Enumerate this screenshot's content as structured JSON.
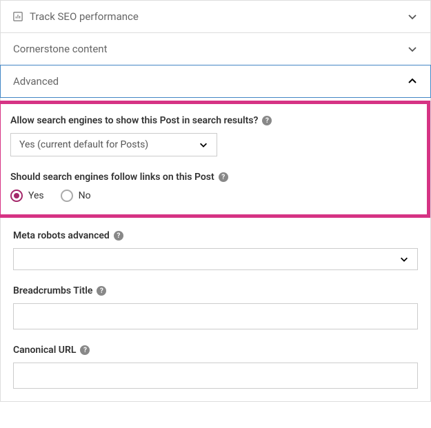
{
  "sections": {
    "seo": {
      "title": "Track SEO performance"
    },
    "cornerstone": {
      "title": "Cornerstone content"
    },
    "advanced": {
      "title": "Advanced"
    }
  },
  "advanced": {
    "allow_search": {
      "label": "Allow search engines to show this Post in search results?",
      "selected": "Yes (current default for Posts)"
    },
    "follow_links": {
      "label": "Should search engines follow links on this Post",
      "yes": "Yes",
      "no": "No"
    },
    "meta_robots": {
      "label": "Meta robots advanced",
      "selected": ""
    },
    "breadcrumbs": {
      "label": "Breadcrumbs Title",
      "value": ""
    },
    "canonical": {
      "label": "Canonical URL",
      "value": ""
    }
  }
}
